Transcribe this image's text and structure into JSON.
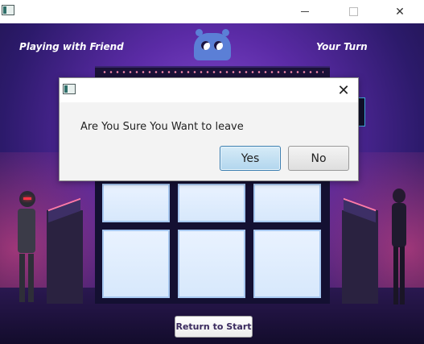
{
  "window": {
    "min_label": "",
    "max_label": "",
    "close_label": "✕"
  },
  "game": {
    "mode_label": "Playing with Friend",
    "turn_label": "Your Turn",
    "return_button_label": "Return to Start",
    "board_cells": [
      "",
      "",
      "",
      "",
      "",
      ""
    ]
  },
  "dialog": {
    "message": "Are You Sure You Want to leave",
    "yes_label": "Yes",
    "no_label": "No",
    "close_label": "✕"
  },
  "colors": {
    "background_purple": "#5b2ba6",
    "accent_pink": "#ff7aa8",
    "default_button_blue": "#3c7fb1"
  }
}
